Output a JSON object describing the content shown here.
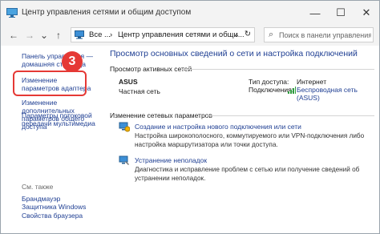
{
  "window": {
    "title": "Центр управления сетями и общим доступом",
    "minimize_glyph": "—",
    "maximize_glyph": "☐",
    "close_glyph": "✕"
  },
  "nav": {
    "back_glyph": "←",
    "forward_glyph": "→",
    "dropdown_glyph": "⌄",
    "up_glyph": "↑",
    "address_parts": [
      "Все ...",
      "›",
      "Центр управления сетями и общи..."
    ],
    "address_chevron": "⌄",
    "refresh_glyph": "↻",
    "search_placeholder": "Поиск в панели управления"
  },
  "sidebar": {
    "home": "Панель управления — домашняя страница",
    "adapter": "Изменение параметров адаптера",
    "sharing": "Изменение дополнительных параметров общего доступа",
    "stream": "Параметры потоковой передачи мультимедиа",
    "see_also": "См. также",
    "firewall": "Брандмауэр Защитника Windows",
    "browser": "Свойства браузера"
  },
  "annotation": {
    "step_number": "3",
    "color": "#e53935"
  },
  "main": {
    "title": "Просмотр основных сведений о сети и настройка подключений",
    "active_networks_label": "Просмотр активных сетей",
    "network_name": "ASUS",
    "network_type": "Частная сеть",
    "access_type_label": "Тип доступа:",
    "access_type_value": "Интернет",
    "connections_label": "Подключения:",
    "connection_value": "Беспроводная сеть (ASUS)",
    "change_settings_label": "Изменение сетевых параметров",
    "actions": [
      {
        "icon": "network-setup-icon",
        "link": "Создание и настройка нового подключения или сети",
        "desc": "Настройка широкополосного, коммутируемого или VPN-подключения либо настройка маршрутизатора или точки доступа."
      },
      {
        "icon": "troubleshoot-icon",
        "link": "Устранение неполадок",
        "desc": "Диагностика и исправление проблем с сетью или получение сведений об устранении неполадок."
      }
    ]
  },
  "colors": {
    "link": "#1f3f93",
    "chrome": "#f3f3f3",
    "highlight": "#e53935"
  }
}
